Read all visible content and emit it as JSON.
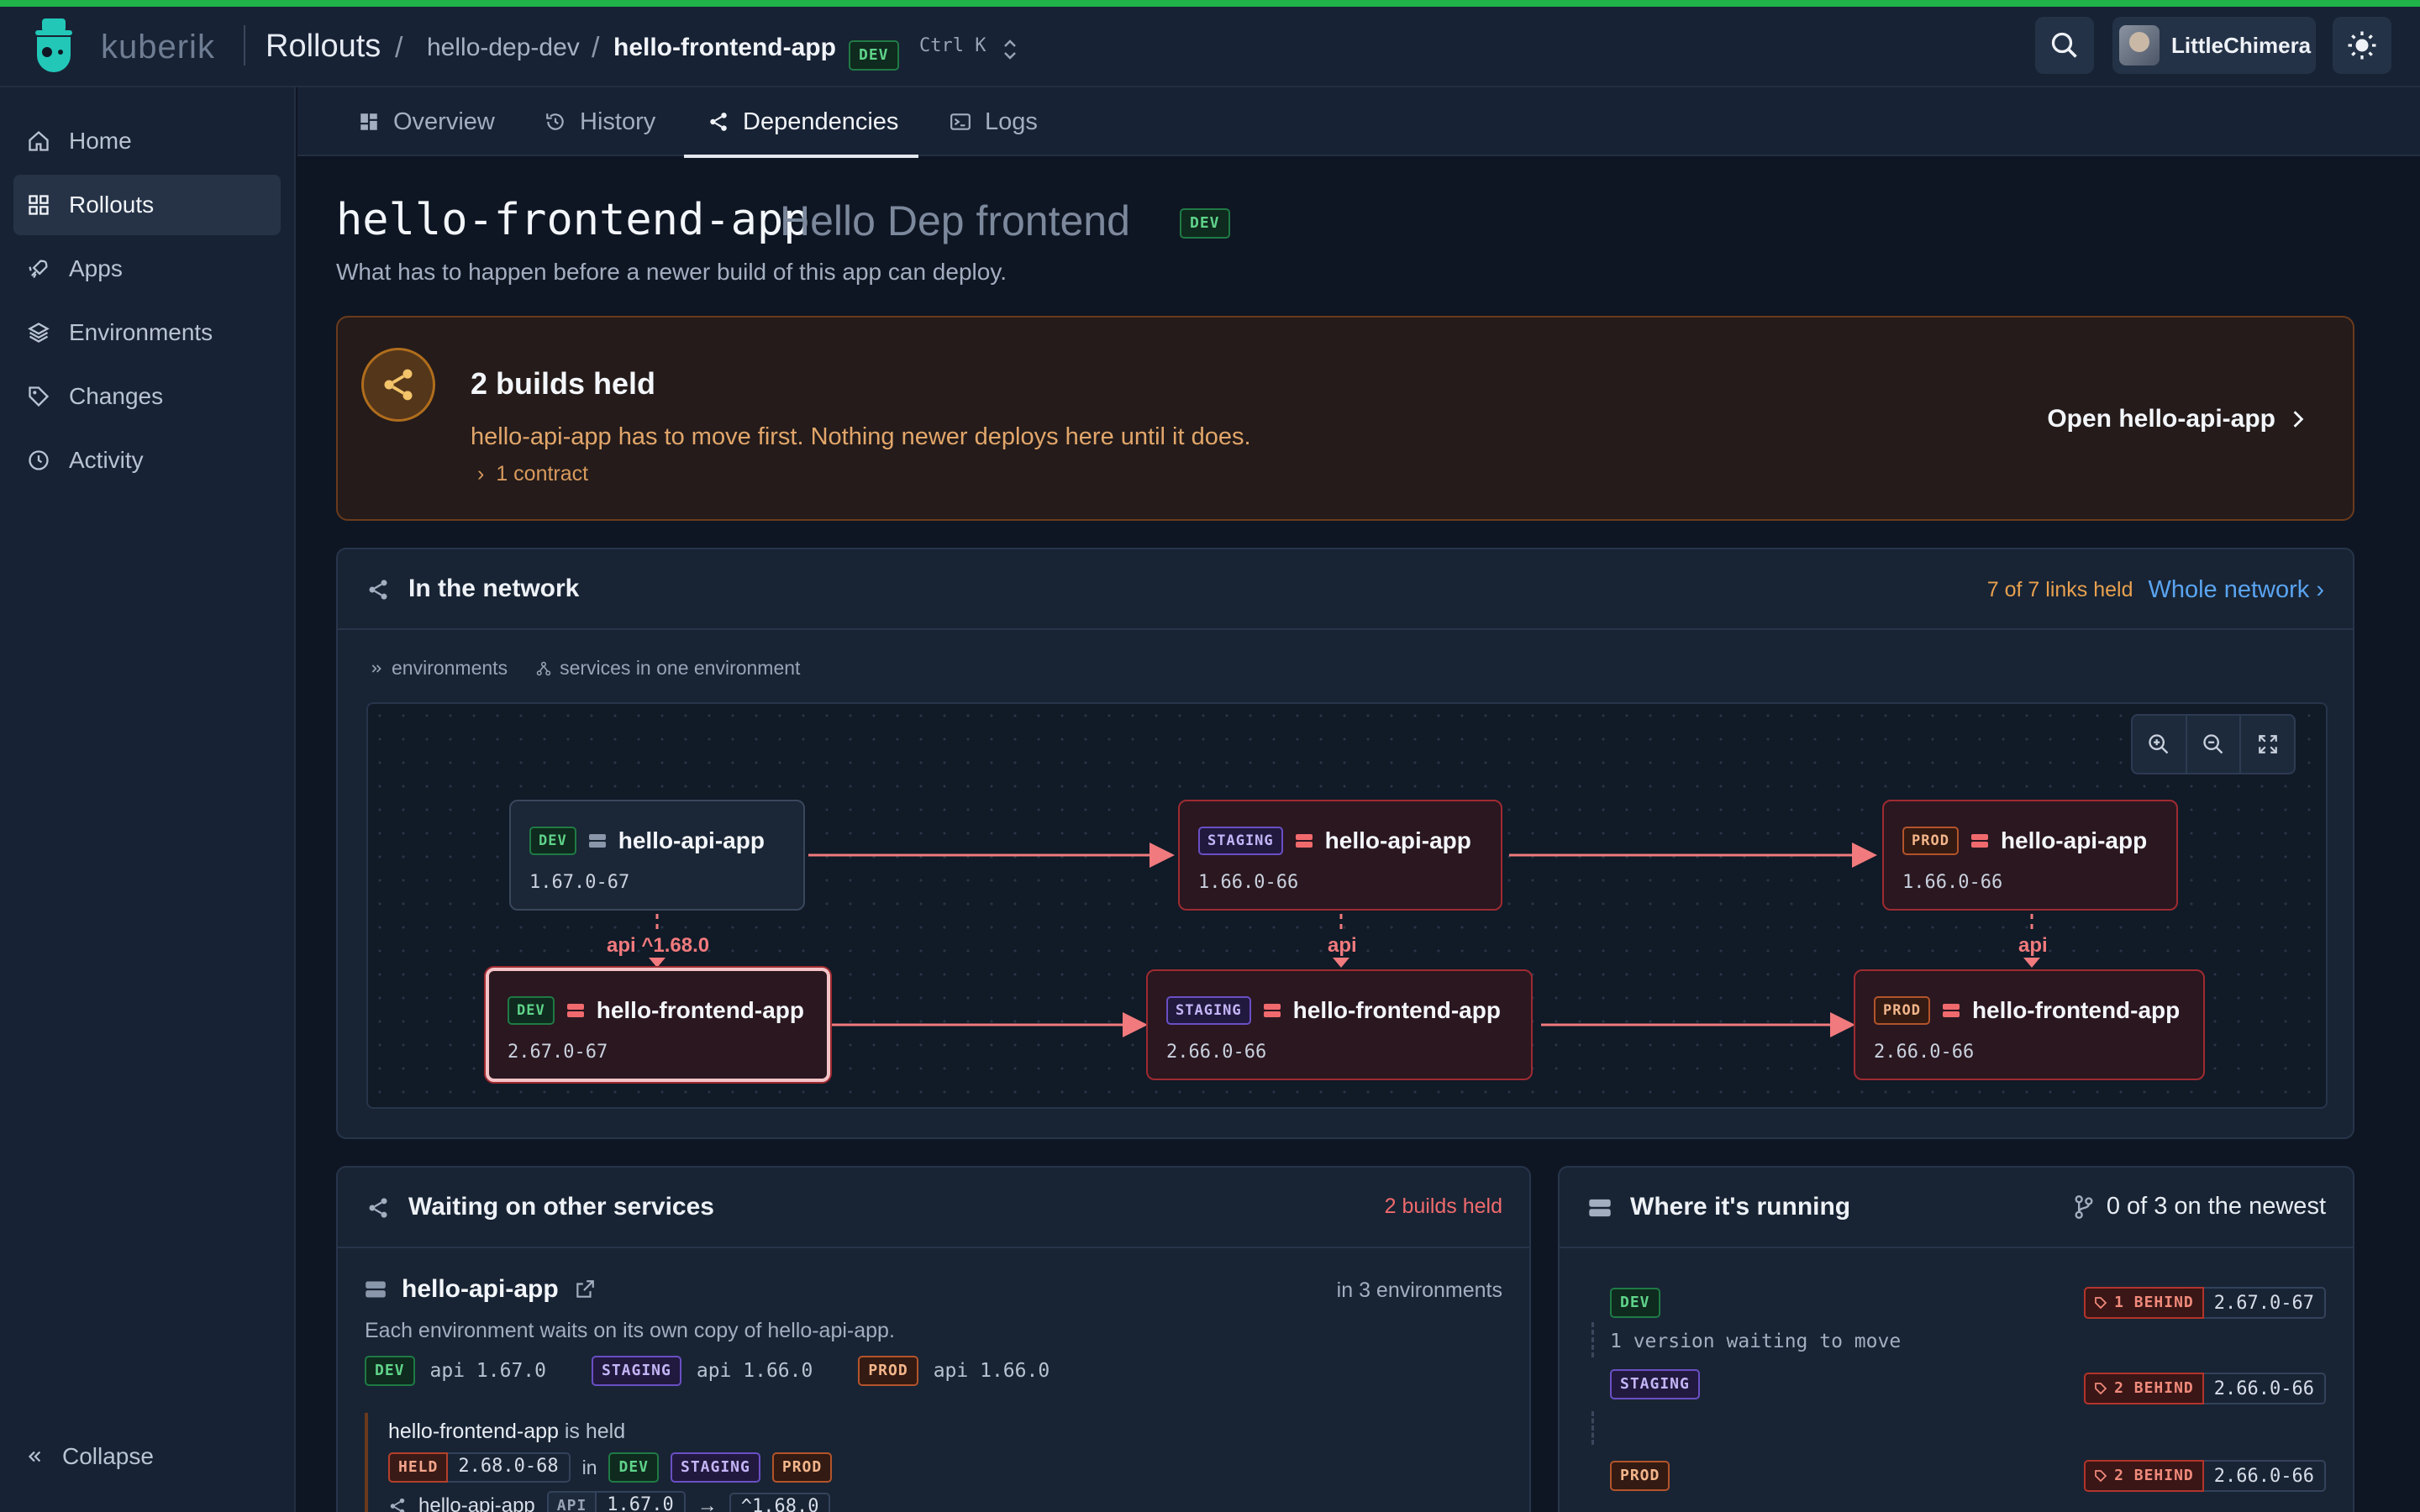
{
  "header": {
    "brand": "kuberik",
    "section": "Rollouts",
    "environment": "hello-dep-dev",
    "app": "hello-frontend-app",
    "app_env_badge": "DEV",
    "shortcut": "Ctrl K",
    "user": "LittleChimera"
  },
  "sidebar": {
    "items": [
      {
        "label": "Home",
        "icon": "home-icon"
      },
      {
        "label": "Rollouts",
        "icon": "grid-icon",
        "active": true
      },
      {
        "label": "Apps",
        "icon": "rocket-icon"
      },
      {
        "label": "Environments",
        "icon": "layers-icon"
      },
      {
        "label": "Changes",
        "icon": "tag-icon"
      },
      {
        "label": "Activity",
        "icon": "clock-icon"
      }
    ],
    "collapse_label": "Collapse"
  },
  "tabs": [
    {
      "label": "Overview",
      "icon": "dashboard-icon"
    },
    {
      "label": "History",
      "icon": "history-icon"
    },
    {
      "label": "Dependencies",
      "icon": "share-icon",
      "active": true
    },
    {
      "label": "Logs",
      "icon": "terminal-icon"
    }
  ],
  "page": {
    "title": "hello-frontend-app",
    "subtitle": "Hello Dep frontend",
    "badge": "DEV",
    "description": "What has to happen before a newer build of this app can deploy."
  },
  "held_banner": {
    "title": "2 builds held",
    "message": "hello-api-app has to move first. Nothing newer deploys here until it does.",
    "contracts": "1 contract",
    "link": "Open hello-api-app",
    "colors": {
      "accent": "#e2a66a",
      "border": "#6b3a1c"
    }
  },
  "network": {
    "title": "In the network",
    "links_held": "7 of 7 links held",
    "whole_network": "Whole network ›",
    "legend": [
      "environments",
      "services in one environment"
    ],
    "nodes": {
      "dev_api": {
        "env": "DEV",
        "name": "hello-api-app",
        "version": "1.67.0-67"
      },
      "staging_api": {
        "env": "STAGING",
        "name": "hello-api-app",
        "version": "1.66.0-66"
      },
      "prod_api": {
        "env": "PROD",
        "name": "hello-api-app",
        "version": "1.66.0-66"
      },
      "dev_fe": {
        "env": "DEV",
        "name": "hello-frontend-app",
        "version": "2.67.0-67"
      },
      "staging_fe": {
        "env": "STAGING",
        "name": "hello-frontend-app",
        "version": "2.66.0-66"
      },
      "prod_fe": {
        "env": "PROD",
        "name": "hello-frontend-app",
        "version": "2.66.0-66"
      }
    },
    "edge_labels": {
      "dev": "api ^1.68.0",
      "staging": "api",
      "prod": "api"
    },
    "colors": {
      "held_edge": "#f07a7d",
      "held_node_border": "#9e2b31"
    }
  },
  "waiting": {
    "title": "Waiting on other services",
    "builds_held": "2 builds held",
    "service": {
      "name": "hello-api-app",
      "env_count": "in 3 environments",
      "description": "Each environment waits on its own copy of hello-api-app.",
      "env_versions": [
        {
          "env": "DEV",
          "value": "api 1.67.0"
        },
        {
          "env": "STAGING",
          "value": "api 1.66.0"
        },
        {
          "env": "PROD",
          "value": "api 1.66.0"
        }
      ]
    },
    "held": {
      "app": "hello-frontend-app",
      "is_held": "is held",
      "tag": "HELD",
      "version": "2.68.0-68",
      "in": "in",
      "envs": [
        "DEV",
        "STAGING",
        "PROD"
      ],
      "dep_name": "hello-api-app",
      "dep_tag": "API",
      "dep_current": "1.67.0",
      "arrow": "→",
      "dep_required": "^1.68.0"
    }
  },
  "running": {
    "title": "Where it's running",
    "summary": "0 of 3 on the newest",
    "rows": [
      {
        "env": "DEV",
        "behind": "1 BEHIND",
        "version": "2.67.0-67"
      },
      {
        "env": "STAGING",
        "behind": "2 BEHIND",
        "version": "2.66.0-66"
      },
      {
        "env": "PROD",
        "behind": "2 BEHIND",
        "version": "2.66.0-66"
      }
    ],
    "note": "1 version waiting to move"
  }
}
